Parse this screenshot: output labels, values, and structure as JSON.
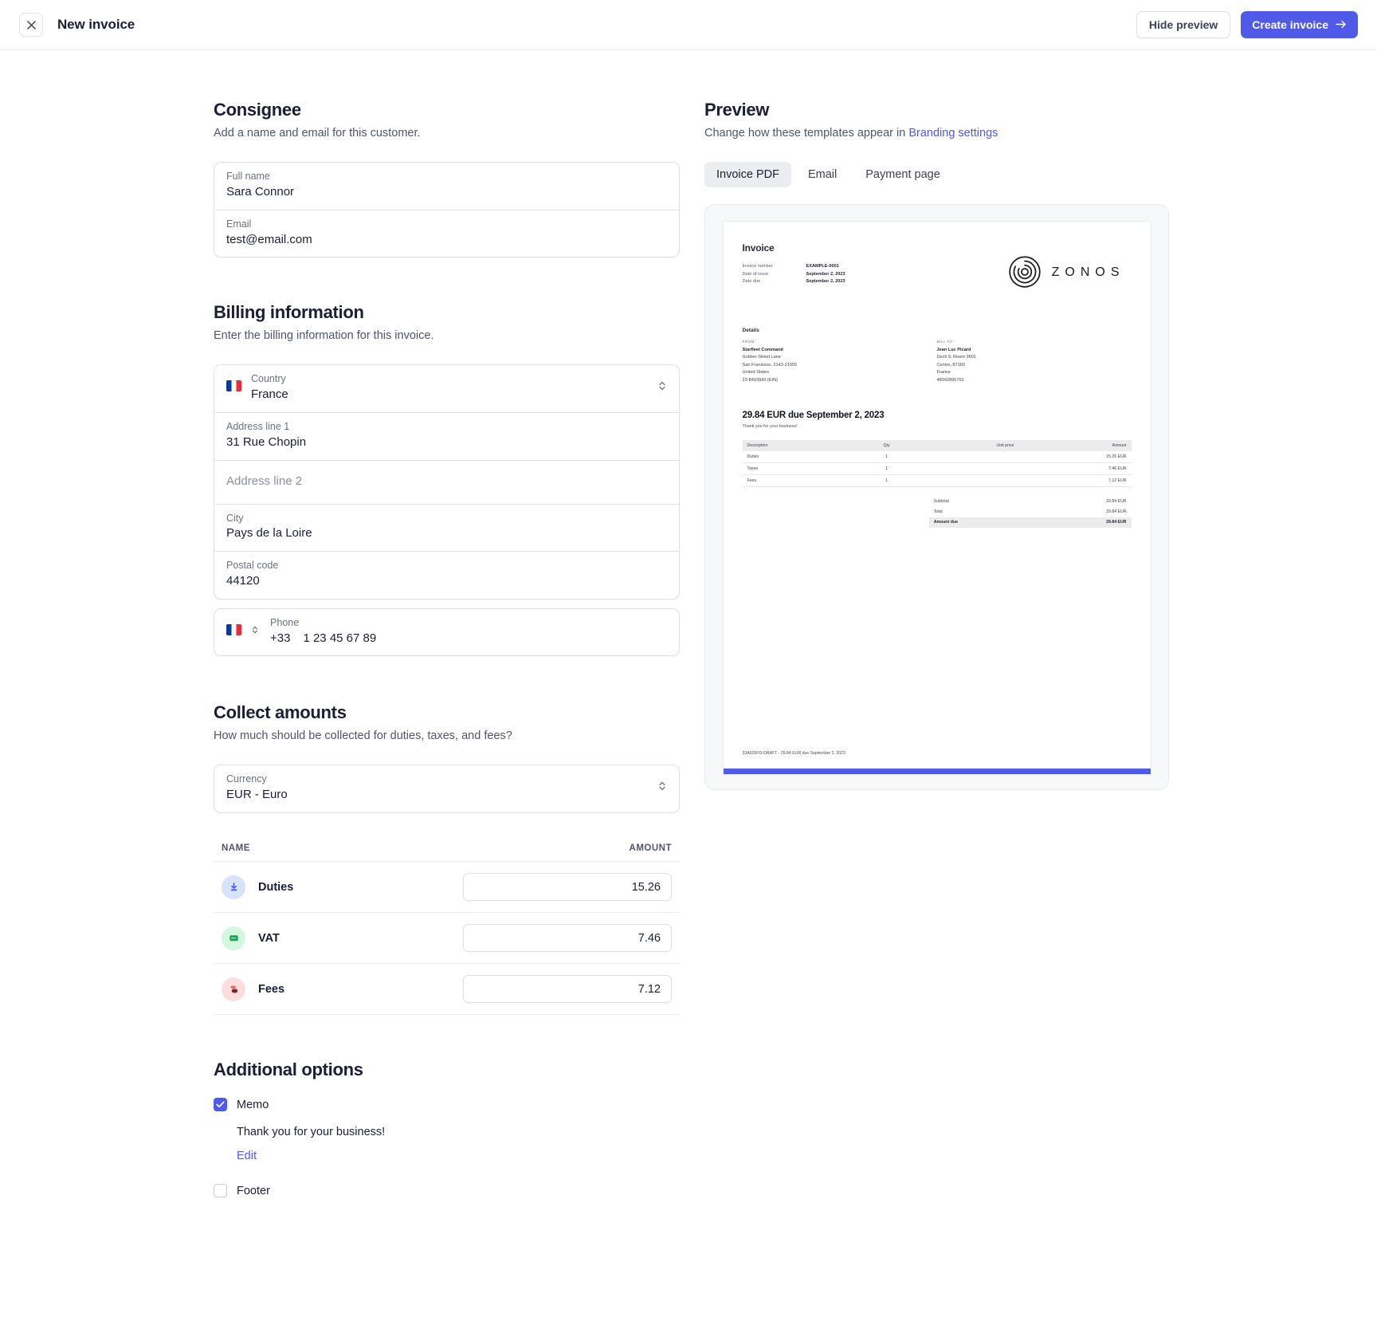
{
  "topbar": {
    "close_icon": "close-icon",
    "title": "New invoice",
    "hide_preview_label": "Hide preview",
    "create_invoice_label": "Create invoice",
    "arrow_icon": "arrow-right-icon",
    "primary_color": "#4f5ae8"
  },
  "consignee": {
    "title": "Consignee",
    "subtitle": "Add a name and email for this customer.",
    "full_name_label": "Full name",
    "full_name_value": "Sara Connor",
    "email_label": "Email",
    "email_value": "test@email.com"
  },
  "billing": {
    "title": "Billing information",
    "subtitle": "Enter the billing information for this invoice.",
    "country_label": "Country",
    "country_value": "France",
    "country_flag": "flag-france-icon",
    "address1_label": "Address line 1",
    "address1_value": "31 Rue Chopin",
    "address2_placeholder": "Address line 2",
    "city_label": "City",
    "city_value": "Pays de la Loire",
    "postal_label": "Postal code",
    "postal_value": "44120",
    "phone_label": "Phone",
    "phone_prefix": "+33",
    "phone_value": "1 23 45 67 89"
  },
  "collect": {
    "title": "Collect amounts",
    "subtitle": "How much should be collected for duties, taxes, and fees?",
    "currency_label": "Currency",
    "currency_value": "EUR - Euro",
    "col_name": "Name",
    "col_amount": "Amount",
    "rows": [
      {
        "name": "Duties",
        "amount": "15.26",
        "icon": "download-arrow-icon",
        "color": "blue"
      },
      {
        "name": "VAT",
        "amount": "7.46",
        "icon": "receipt-card-icon",
        "color": "green"
      },
      {
        "name": "Fees",
        "amount": "7.12",
        "icon": "coins-stack-icon",
        "color": "red"
      }
    ]
  },
  "additional": {
    "title": "Additional options",
    "memo_label": "Memo",
    "memo_checked": true,
    "memo_text": "Thank you for your business!",
    "edit_label": "Edit",
    "footer_label": "Footer",
    "footer_checked": false
  },
  "preview": {
    "title": "Preview",
    "subtitle_prefix": "Change how these templates appear in ",
    "branding_link": "Branding settings",
    "tabs": [
      {
        "label": "Invoice PDF",
        "active": true
      },
      {
        "label": "Email",
        "active": false
      },
      {
        "label": "Payment page",
        "active": false
      }
    ]
  },
  "invoice": {
    "title": "Invoice",
    "meta": [
      {
        "key": "Invoice number",
        "value": "EXAMPLE-0001"
      },
      {
        "key": "Date of issue",
        "value": "September 2, 2023"
      },
      {
        "key": "Date due",
        "value": "September 2, 2023"
      }
    ],
    "logo_word": "ZONOS",
    "logo_icon": "zonos-logo-icon",
    "details_title": "Details",
    "from_heading": "FROM",
    "from_name": "Starfleet Command",
    "from_lines": [
      "Golden Street Lane",
      "San Fransisco, 2143-21555",
      "United States",
      "23-8493943 (EIN)"
    ],
    "billto_heading": "BILL TO",
    "billto_name": "Jean Luc Picard",
    "billto_lines": [
      "Deck 9, Room 3601",
      "Centre, 87160",
      "France",
      "48942895762"
    ],
    "due_line": "29.84 EUR due September 2, 2023",
    "memo": "Thank you for your business!",
    "table_headers": [
      "Description",
      "Qty",
      "Unit price",
      "Amount"
    ],
    "table_rows": [
      {
        "description": "Duties",
        "qty": "1",
        "unit_price": "",
        "amount": "15.26 EUR"
      },
      {
        "description": "Taxes",
        "qty": "1",
        "unit_price": "",
        "amount": "7.46 EUR"
      },
      {
        "description": "Fees",
        "qty": "1",
        "unit_price": "",
        "amount": "7.12 EUR"
      }
    ],
    "totals": [
      {
        "label": "Subtotal",
        "value": "29.84 EUR"
      },
      {
        "label": "Total",
        "value": "29.84 EUR"
      },
      {
        "label": "Amount due",
        "value": "29.84 EUR"
      }
    ],
    "footer": "33A605FD-DRAFT - 29.84 EUR due September 2, 2023"
  }
}
